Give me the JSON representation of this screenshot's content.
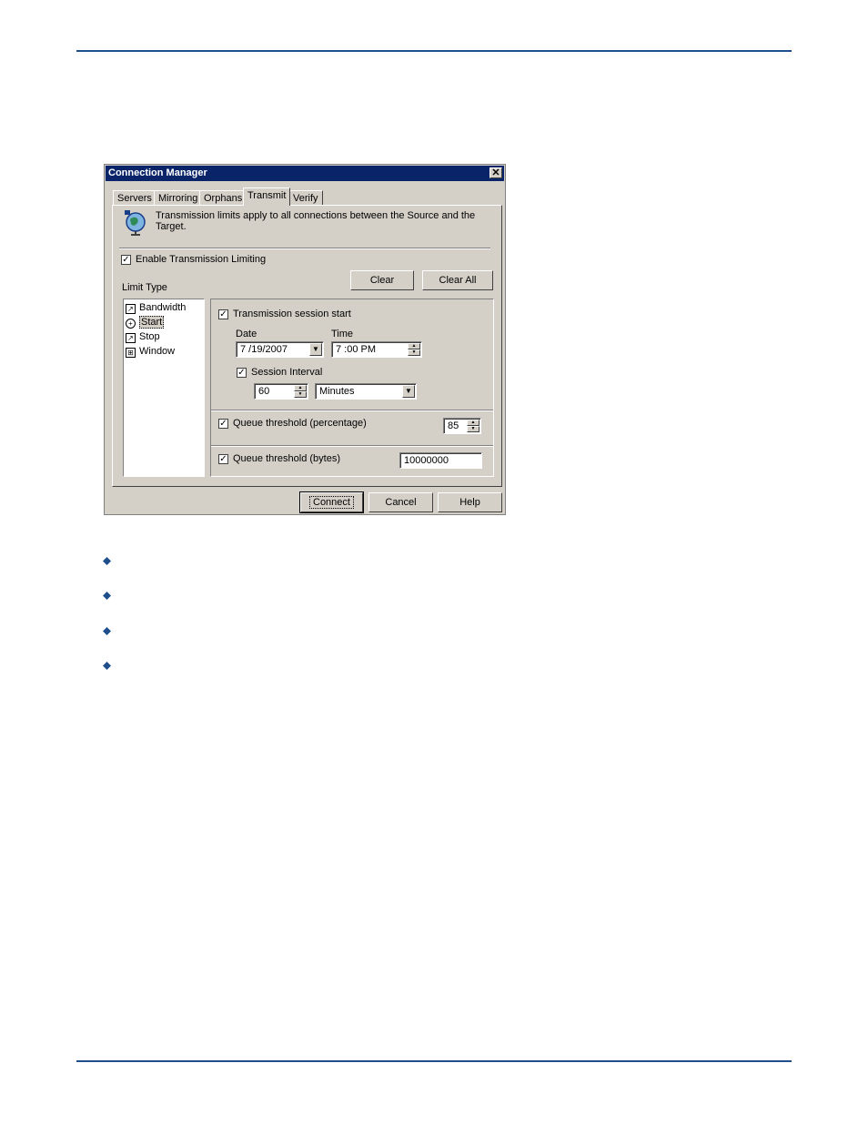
{
  "dialog": {
    "title": "Connection Manager",
    "close_glyph": "✕",
    "tabs": [
      {
        "label": "Servers"
      },
      {
        "label": "Mirroring"
      },
      {
        "label": "Orphans"
      },
      {
        "label": "Transmit",
        "active": true
      },
      {
        "label": "Verify"
      }
    ],
    "info_text": "Transmission limits apply to all connections between the Source and the Target.",
    "enable_limiting": {
      "label": "Enable Transmission Limiting",
      "checked": true
    },
    "clear_label": "Clear",
    "clear_all_label": "Clear All",
    "limit_type_label": "Limit Type",
    "limit_types": [
      {
        "label": "Bandwidth",
        "icon": "chart-icon"
      },
      {
        "label": "Start",
        "icon": "clock-icon",
        "selected": true
      },
      {
        "label": "Stop",
        "icon": "chart-icon"
      },
      {
        "label": "Window",
        "icon": "window-icon"
      }
    ],
    "session_start": {
      "label": "Transmission session start",
      "checked": true
    },
    "date_label": "Date",
    "date_value": "7 /19/2007",
    "time_label": "Time",
    "time_value": "7 :00 PM",
    "session_interval": {
      "label": "Session Interval",
      "checked": true
    },
    "interval_value": "60",
    "interval_unit": "Minutes",
    "queue_pct": {
      "label": "Queue threshold (percentage)",
      "checked": true,
      "value": "85"
    },
    "queue_bytes": {
      "label": "Queue threshold (bytes)",
      "checked": true,
      "value": "10000000"
    },
    "connect_label": "Connect",
    "cancel_label": "Cancel",
    "help_label": "Help"
  },
  "colors": {
    "rule": "#1f4e8c",
    "titlebar": "#0a246a",
    "bullet": "#1f4e8c",
    "dialog_face": "#d4d0c8"
  }
}
